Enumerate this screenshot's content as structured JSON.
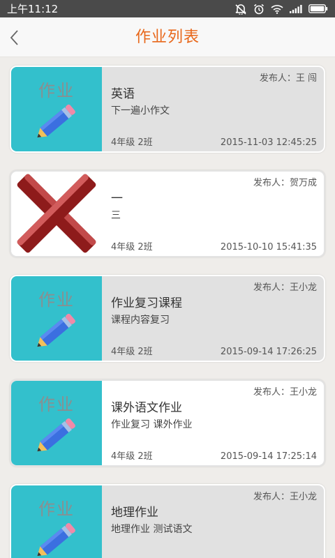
{
  "status_bar": {
    "time": "上午11:12",
    "icons": [
      "mute-icon",
      "alarm-icon",
      "wifi-icon",
      "signal-icon",
      "battery-icon"
    ]
  },
  "header": {
    "title": "作业列表",
    "back_icon": "chevron-left-icon"
  },
  "colors": {
    "accent": "#e8671a",
    "thumb_bg": "#33c0cc",
    "card_bg": "#e1e1e1"
  },
  "items": [
    {
      "thumb_label": "作业",
      "thumb_icon": "pencil-icon",
      "publisher": "发布人：王 闯",
      "title": "英语",
      "desc": "下一遍小作文",
      "grade": "4年级 2班",
      "time": "2015-11-03 12:45:25"
    },
    {
      "thumb_label": "",
      "thumb_icon": "red-cross-icon",
      "publisher": "发布人：贺万成",
      "title": "一",
      "desc": "三",
      "grade": "4年级 2班",
      "time": "2015-10-10 15:41:35"
    },
    {
      "thumb_label": "作业",
      "thumb_icon": "pencil-icon",
      "publisher": "发布人：王小龙",
      "title": "作业复习课程",
      "desc": "课程内容复习",
      "grade": "4年级 2班",
      "time": "2015-09-14 17:26:25"
    },
    {
      "thumb_label": "作业",
      "thumb_icon": "pencil-icon",
      "publisher": "发布人：王小龙",
      "title": "课外语文作业",
      "desc": "作业复习  课外作业",
      "grade": "4年级 2班",
      "time": "2015-09-14 17:25:14"
    },
    {
      "thumb_label": "作业",
      "thumb_icon": "pencil-icon",
      "publisher": "发布人：王小龙",
      "title": "地理作业",
      "desc": "地理作业  测试语文",
      "grade": "",
      "time": ""
    }
  ]
}
